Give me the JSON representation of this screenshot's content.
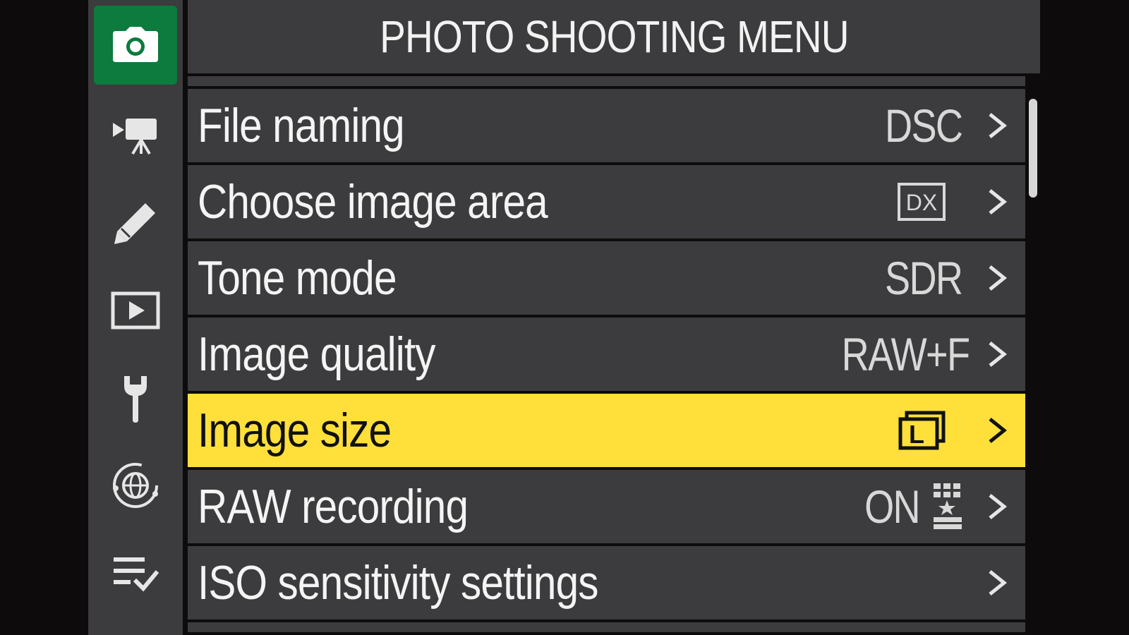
{
  "header": {
    "title": "PHOTO SHOOTING MENU"
  },
  "rail": {
    "tabs": [
      {
        "icon": "camera-icon",
        "active": true
      },
      {
        "icon": "movie-camera-icon",
        "active": false
      },
      {
        "icon": "pencil-icon",
        "active": false
      },
      {
        "icon": "playback-icon",
        "active": false
      },
      {
        "icon": "wrench-icon",
        "active": false
      },
      {
        "icon": "network-globe-icon",
        "active": false
      },
      {
        "icon": "my-menu-checklist-icon",
        "active": false
      }
    ],
    "active_color": "#0d7a3e"
  },
  "menu": {
    "selected_color": "#ffe03a",
    "items": [
      {
        "label": "File naming",
        "value": "DSC",
        "value_icon": ""
      },
      {
        "label": "Choose image area",
        "value": "DX",
        "value_icon": "dx-crop-icon"
      },
      {
        "label": "Tone mode",
        "value": "SDR",
        "value_icon": ""
      },
      {
        "label": "Image quality",
        "value": "RAW+F",
        "value_icon": ""
      },
      {
        "label": "Image size",
        "value": "L",
        "value_icon": "large-size-icon",
        "selected": true
      },
      {
        "label": "RAW recording",
        "value": "ON",
        "value_icon": "raw-recording-grid-star-icon"
      },
      {
        "label": "ISO sensitivity settings",
        "value": "",
        "value_icon": ""
      }
    ]
  }
}
